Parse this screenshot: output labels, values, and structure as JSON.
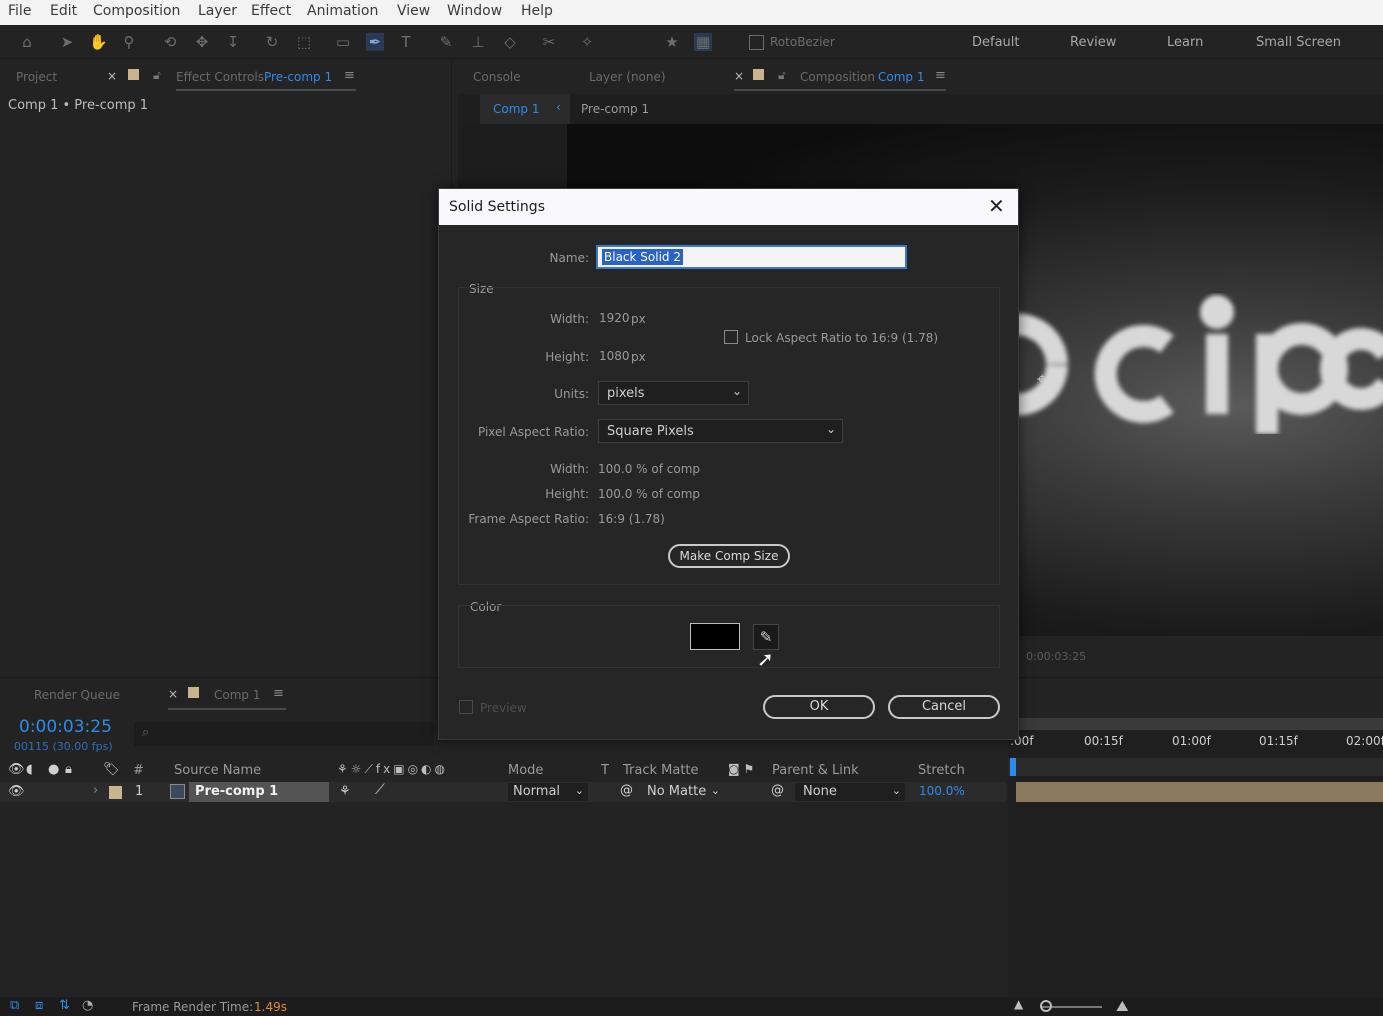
{
  "menu": [
    "File",
    "Edit",
    "Composition",
    "Layer",
    "Effect",
    "Animation",
    "View",
    "Window",
    "Help"
  ],
  "toolbar": {
    "rotobezier_label": "RotoBezier",
    "workspaces": [
      "Default",
      "Review",
      "Learn",
      "Small Screen"
    ]
  },
  "left_panel": {
    "tab_project": "Project",
    "tab_effect_controls": "Effect Controls",
    "tab_effect_target": "Pre-comp 1",
    "breadcrumb": "Comp 1 • Pre-comp 1"
  },
  "right_panel": {
    "tab_console": "Console",
    "tab_layer": "Layer (none)",
    "tab_composition": "Composition",
    "tab_composition_target": "Comp 1",
    "subtab_comp1": "Comp 1",
    "subtab_precomp": "Pre-comp 1",
    "viewer_timecode": "0:00:03:25"
  },
  "dialog": {
    "title": "Solid Settings",
    "name_label": "Name:",
    "name_value": "Black Solid 2",
    "size_group": "Size",
    "width_label": "Width:",
    "width_value": "1920",
    "width_unit": "px",
    "height_label": "Height:",
    "height_value": "1080",
    "height_unit": "px",
    "lock_aspect_label": "Lock Aspect Ratio to 16:9 (1.78)",
    "units_label": "Units:",
    "units_value": "pixels",
    "par_label": "Pixel Aspect Ratio:",
    "par_value": "Square Pixels",
    "pct_width_label": "Width:",
    "pct_width_value": "100.0 % of comp",
    "pct_height_label": "Height:",
    "pct_height_value": "100.0 % of comp",
    "far_label": "Frame Aspect Ratio:",
    "far_value": "16:9 (1.78)",
    "make_comp_size": "Make Comp Size",
    "color_group": "Color",
    "color_swatch": "#000000",
    "preview_label": "Preview",
    "ok_label": "OK",
    "cancel_label": "Cancel"
  },
  "timeline": {
    "tab_render_queue": "Render Queue",
    "tab_comp": "Comp 1",
    "timecode": "0:00:03:25",
    "frames": "00115 (30.00 fps)",
    "col_hash": "#",
    "col_source": "Source Name",
    "col_mode": "Mode",
    "col_t": "T",
    "col_track_matte": "Track Matte",
    "col_parent": "Parent & Link",
    "col_stretch": "Stretch",
    "ruler": [
      ":00f",
      "00:15f",
      "01:00f",
      "01:15f",
      "02:00f"
    ],
    "layer": {
      "index": "1",
      "name": "Pre-comp 1",
      "mode": "Normal",
      "matte": "No Matte",
      "parent": "None",
      "stretch": "100.0%"
    }
  },
  "status": {
    "frame_render_label": "Frame Render Time:",
    "frame_render_value": "1.49s"
  },
  "colors": {
    "accent": "#2d8ceb",
    "swatch": "#c9b48b",
    "render_time": "#e08a3a"
  }
}
